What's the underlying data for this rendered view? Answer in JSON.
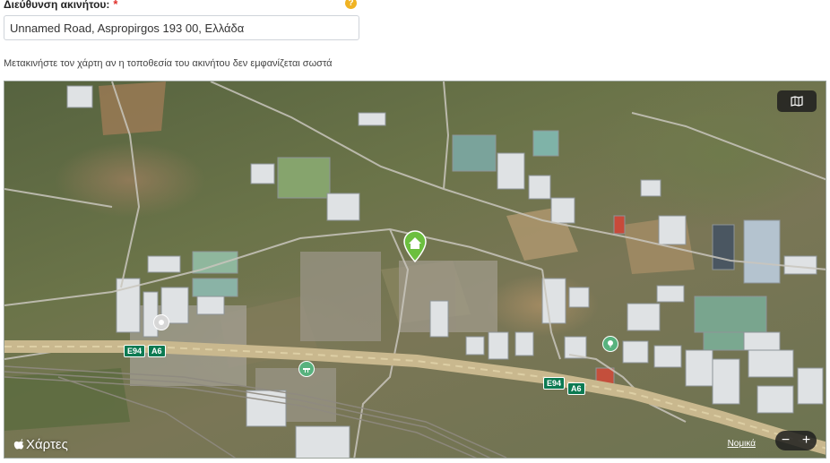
{
  "form": {
    "address_label": "Διεύθυνση ακινήτου:",
    "required_mark": "*",
    "help_icon_glyph": "?",
    "address_value": "Unnamed Road, Aspropirgos 193 00, Ελλάδα",
    "help_text": "Μετακινήστε τον χάρτη αν η τοποθεσία του ακινήτου δεν εμφανίζεται σωστά"
  },
  "map": {
    "brand_label": "Χάρτες",
    "legal_link": "Νομικά",
    "zoom_out": "−",
    "zoom_in": "+",
    "map_type_icon": "map-icon",
    "road_shields": [
      {
        "label": "E94"
      },
      {
        "label": "A6"
      },
      {
        "label": "E94"
      },
      {
        "label": "A6"
      }
    ],
    "pin_color": "#6cbf3f"
  }
}
